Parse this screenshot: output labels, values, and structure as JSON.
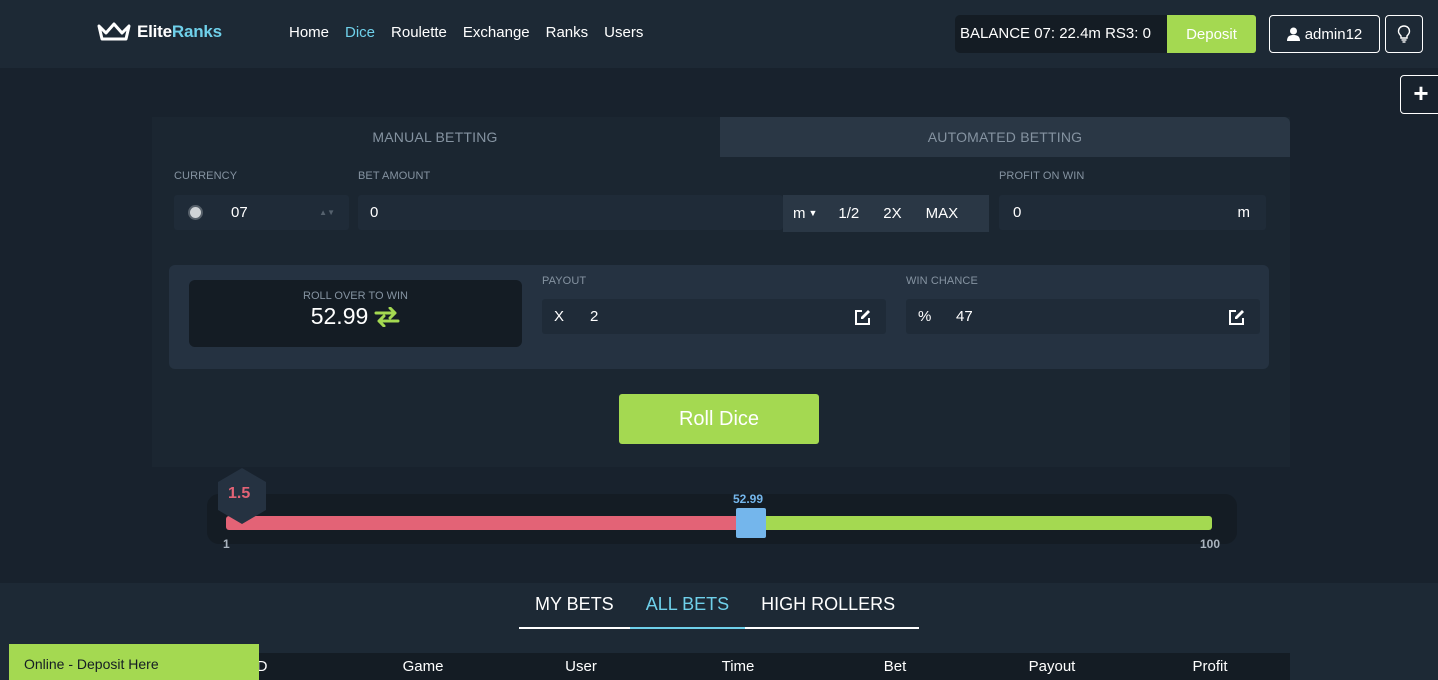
{
  "header": {
    "logo": {
      "elite": "Elite",
      "ranks": "Ranks"
    },
    "nav": [
      "Home",
      "Dice",
      "Roulette",
      "Exchange",
      "Ranks",
      "Users"
    ],
    "active_nav": "Dice",
    "balance": "BALANCE 07: 22.4m RS3: 0",
    "deposit_label": "Deposit",
    "username": "admin12",
    "icons": {
      "user": "user-icon",
      "bulb": "lightbulb-icon",
      "plus": "plus-icon"
    }
  },
  "betting": {
    "tabs": {
      "manual": "MANUAL BETTING",
      "automated": "AUTOMATED BETTING"
    },
    "currency_label": "CURRENCY",
    "currency_value": "07",
    "bet_amount_label": "BET AMOUNT",
    "bet_amount_value": "0",
    "unit_selector": "m",
    "half_label": "1/2",
    "double_label": "2X",
    "max_label": "MAX",
    "profit_label": "PROFIT ON WIN",
    "profit_value": "0",
    "profit_unit": "m",
    "roll_over_label": "ROLL OVER TO WIN",
    "roll_over_value": "52.99",
    "payout_label": "PAYOUT",
    "payout_prefix": "X",
    "payout_value": "2",
    "win_chance_label": "WIN CHANCE",
    "win_chance_prefix": "%",
    "win_chance_value": "47",
    "roll_button": "Roll Dice"
  },
  "slider": {
    "min": "1",
    "max": "100",
    "value": "52.99",
    "last_roll": "1.5",
    "colors": {
      "lose": "#e36376",
      "win": "#a4d951",
      "thumb": "#74b6ec"
    }
  },
  "bets": {
    "tabs": [
      "MY BETS",
      "ALL BETS",
      "HIGH ROLLERS"
    ],
    "active_tab": "ALL BETS",
    "columns": [
      "ID",
      "Game",
      "User",
      "Time",
      "Bet",
      "Payout",
      "Profit"
    ]
  },
  "online_bar": "Online - Deposit Here",
  "colors": {
    "accent": "#6fd0ea",
    "green": "#a4d951",
    "red": "#e36376"
  }
}
